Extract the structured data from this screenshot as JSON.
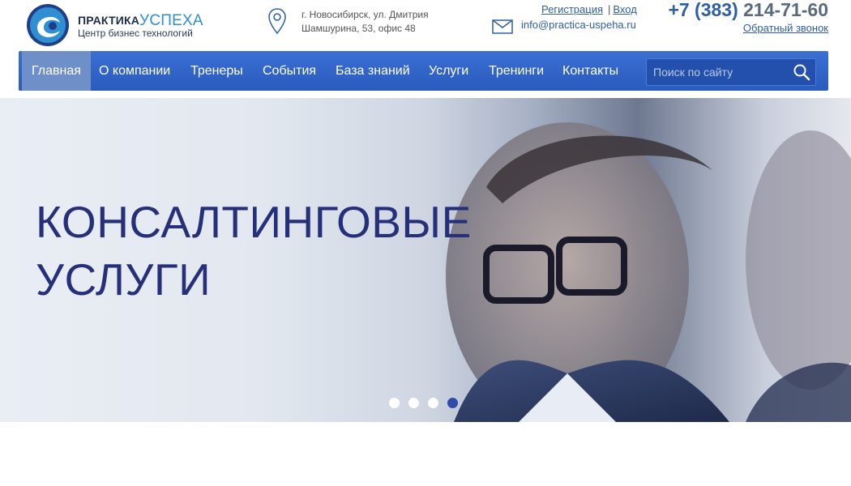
{
  "header": {
    "logo": {
      "name": "ПРАКТИКА",
      "name_accent": "УСПЕХА",
      "tagline": "Центр бизнес технологий"
    },
    "address": {
      "line1": "г. Новосибирск, ул. Дмитрия",
      "line2": "Шамшурина, 53, офис 48"
    },
    "email": "info@practica-uspeha.ru",
    "links": {
      "register": "Регистрация",
      "separator": "|",
      "login": "Вход"
    },
    "phone": {
      "code": "+7 (383)",
      "number": "214-71-60"
    },
    "callback": "Обратный звонок"
  },
  "nav": {
    "items": [
      {
        "label": "Главная",
        "active": true
      },
      {
        "label": "О компании"
      },
      {
        "label": "Тренеры"
      },
      {
        "label": "События"
      },
      {
        "label": "База знаний"
      },
      {
        "label": "Услуги"
      },
      {
        "label": "Тренинги"
      },
      {
        "label": "Контакты"
      }
    ],
    "search": {
      "placeholder": "Поиск по сайту"
    }
  },
  "hero": {
    "title_line1": "КОНСАЛТИНГОВЫЕ",
    "title_line2": "УСЛУГИ",
    "slides_count": 4,
    "active_slide": 4
  },
  "colors": {
    "brand_blue": "#2e5ea8",
    "nav_bg": "#3366cc",
    "hero_text": "#26307a",
    "nav_active": "#6f8fc9"
  }
}
